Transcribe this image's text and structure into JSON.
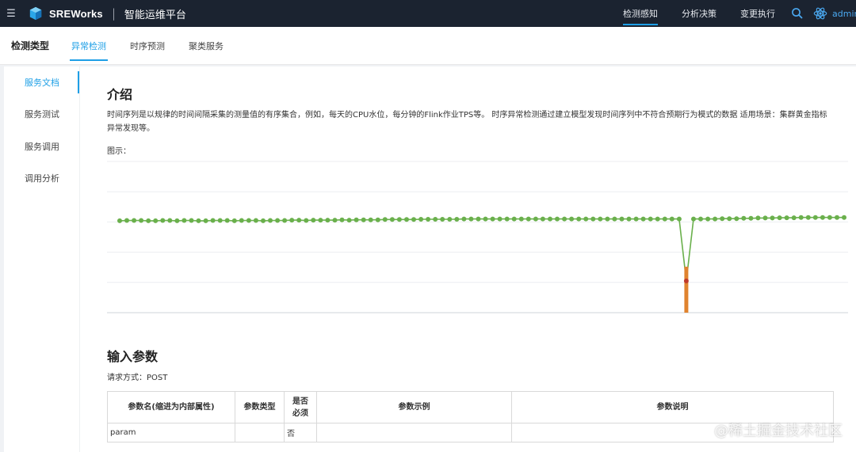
{
  "topbar": {
    "menu_icon": "menu-icon",
    "brand": "SREWorks",
    "separator": "|",
    "platform": "智能运维平台",
    "nav": [
      "检测感知",
      "分析决策",
      "变更执行"
    ],
    "active_nav": "检测感知",
    "user": "admin"
  },
  "subbar": {
    "title": "检测类型",
    "tabs": [
      "异常检测",
      "时序预测",
      "聚类服务"
    ],
    "active_tab": "异常检测"
  },
  "sidenav": {
    "items": [
      "服务文档",
      "服务测试",
      "服务调用",
      "调用分析"
    ],
    "active": "服务文档"
  },
  "content": {
    "intro_title": "介绍",
    "intro_text": "时间序列是以规律的时间间隔采集的测量值的有序集合，例如，每天的CPU水位，每分钟的Flink作业TPS等。 时序异常检测通过建立模型发现时间序列中不符合预期行为模式的数据 适用场景：集群黄金指标异常发现等。",
    "figure_label": "图示：",
    "input_title": "输入参数",
    "request_method": "请求方式：POST"
  },
  "chart_data": {
    "type": "line",
    "title": "",
    "xlabel": "",
    "ylabel": "",
    "ylim": [
      0,
      5
    ],
    "grid": true,
    "series": [
      {
        "values": [
          3.04,
          3.05,
          3.05,
          3.05,
          3.04,
          3.04,
          3.05,
          3.05,
          3.04,
          3.05,
          3.05,
          3.04,
          3.04,
          3.05,
          3.05,
          3.05,
          3.04,
          3.05,
          3.05,
          3.05,
          3.04,
          3.05,
          3.05,
          3.05,
          3.06,
          3.06,
          3.05,
          3.06,
          3.06,
          3.06,
          3.06,
          3.07,
          3.06,
          3.07,
          3.07,
          3.07,
          3.07,
          3.08,
          3.08,
          3.08,
          3.08,
          3.08,
          3.09,
          3.09,
          3.09,
          3.09,
          3.09,
          3.09,
          3.1,
          3.1,
          3.1,
          3.1,
          3.1,
          3.1,
          3.1,
          3.1,
          3.1,
          3.1,
          3.1,
          3.1,
          3.1,
          3.1,
          3.1,
          3.1,
          3.1,
          3.1,
          3.1,
          3.1,
          3.1,
          3.1,
          3.1,
          3.1,
          3.1,
          3.1,
          3.1,
          3.1,
          3.1,
          3.1,
          3.1,
          1.05,
          3.1,
          3.1,
          3.1,
          3.1,
          3.11,
          3.11,
          3.11,
          3.12,
          3.12,
          3.13,
          3.13,
          3.13,
          3.14,
          3.14,
          3.14,
          3.15,
          3.15,
          3.15,
          3.15,
          3.15,
          3.15,
          3.15
        ],
        "color": "#6ab04c"
      }
    ],
    "anomalies": [
      {
        "index": 79,
        "value": 1.05,
        "color": "#e0832f"
      }
    ]
  },
  "params_table": {
    "headers": [
      "参数名(缩进为内部属性)",
      "参数类型",
      "是否必须",
      "参数示例",
      "参数说明"
    ],
    "rows": [
      [
        "param",
        "",
        "否",
        "",
        ""
      ]
    ]
  },
  "watermark": "@稀土掘金技术社区"
}
